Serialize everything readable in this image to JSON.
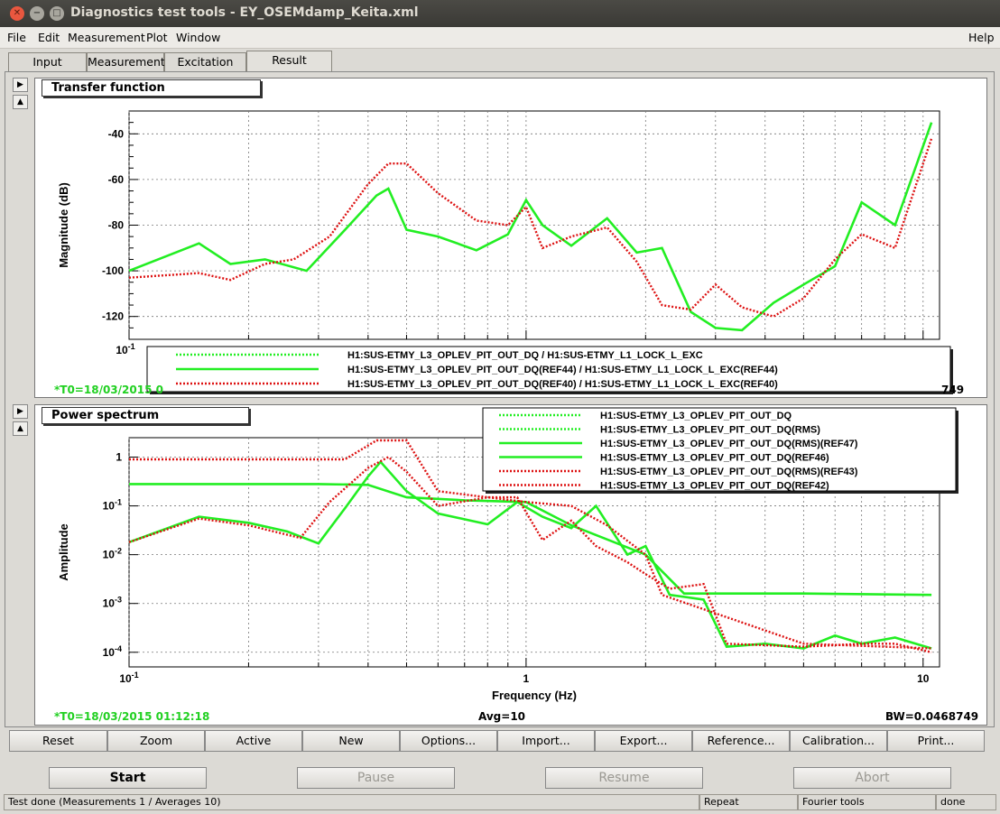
{
  "window": {
    "title": "Diagnostics test tools - EY_OSEMdamp_Keita.xml"
  },
  "menu": {
    "file": "File",
    "edit": "Edit",
    "measurement": "Measurement",
    "plot": "Plot",
    "window": "Window",
    "help": "Help"
  },
  "tabs": [
    "Input",
    "Measurement",
    "Excitation",
    "Result"
  ],
  "top_panel": {
    "title": "Transfer function",
    "ylabel": "Magnitude (dB)",
    "t0_left": "*T0=18/03/2015 0",
    "bw_right": "749",
    "legend": [
      "H1:SUS-ETMY_L3_OPLEV_PIT_OUT_DQ / H1:SUS-ETMY_L1_LOCK_L_EXC",
      "H1:SUS-ETMY_L3_OPLEV_PIT_OUT_DQ(REF44) / H1:SUS-ETMY_L1_LOCK_L_EXC(REF44)",
      "H1:SUS-ETMY_L3_OPLEV_PIT_OUT_DQ(REF40) / H1:SUS-ETMY_L1_LOCK_L_EXC(REF40)"
    ],
    "yticks": [
      "-40",
      "-60",
      "-80",
      "-100",
      "-120"
    ],
    "xtick_first": "10^-1"
  },
  "bottom_panel": {
    "title": "Power spectrum",
    "ylabel": "Amplitude",
    "xlabel": "Frequency (Hz)",
    "t0": "*T0=18/03/2015 01:12:18",
    "avg": "Avg=10",
    "bw": "BW=0.0468749",
    "legend": [
      "H1:SUS-ETMY_L3_OPLEV_PIT_OUT_DQ",
      "H1:SUS-ETMY_L3_OPLEV_PIT_OUT_DQ(RMS)",
      "H1:SUS-ETMY_L3_OPLEV_PIT_OUT_DQ(RMS)(REF47)",
      "H1:SUS-ETMY_L3_OPLEV_PIT_OUT_DQ(REF46)",
      "H1:SUS-ETMY_L3_OPLEV_PIT_OUT_DQ(RMS)(REF43)",
      "H1:SUS-ETMY_L3_OPLEV_PIT_OUT_DQ(REF42)"
    ],
    "yticks": [
      "1",
      "10^-1",
      "10^-2",
      "10^-3",
      "10^-4"
    ],
    "xticks": [
      "10^-1",
      "1",
      "10"
    ]
  },
  "buttons": [
    "Reset",
    "Zoom",
    "Active",
    "New",
    "Options...",
    "Import...",
    "Export...",
    "Reference...",
    "Calibration...",
    "Print..."
  ],
  "main_buttons": {
    "start": "Start",
    "pause": "Pause",
    "resume": "Resume",
    "abort": "Abort"
  },
  "status": {
    "msg": "Test done (Measurements 1 / Averages 10)",
    "repeat": "Repeat",
    "tools": "Fourier tools",
    "state": "done"
  },
  "chart_data": [
    {
      "type": "line",
      "title": "Transfer function",
      "xlabel": "",
      "ylabel": "Magnitude (dB)",
      "xscale": "log",
      "ylim": [
        -130,
        -30
      ],
      "series": [
        {
          "name": "H1:SUS-ETMY_L3_OPLEV_PIT_OUT_DQ(REF44) / H1:SUS-ETMY_L1_LOCK_L_EXC(REF44)",
          "style": "solid",
          "color": "#22ee22",
          "x": [
            0.1,
            0.15,
            0.18,
            0.22,
            0.28,
            0.35,
            0.42,
            0.45,
            0.5,
            0.6,
            0.75,
            0.9,
            1.0,
            1.1,
            1.3,
            1.6,
            1.9,
            2.2,
            2.6,
            3.0,
            3.5,
            4.2,
            5.0,
            6.0,
            7.0,
            8.5,
            10.5
          ],
          "y": [
            -100,
            -88,
            -97,
            -95,
            -100,
            -82,
            -67,
            -64,
            -82,
            -85,
            -91,
            -84,
            -69,
            -80,
            -89,
            -77,
            -92,
            -90,
            -118,
            -125,
            -126,
            -114,
            -106,
            -98,
            -70,
            -80,
            -35
          ]
        },
        {
          "name": "H1:SUS-ETMY_L3_OPLEV_PIT_OUT_DQ(REF40) / H1:SUS-ETMY_L1_LOCK_L_EXC(REF40)",
          "style": "dotted",
          "color": "#dd1111",
          "x": [
            0.1,
            0.15,
            0.18,
            0.22,
            0.26,
            0.32,
            0.4,
            0.45,
            0.5,
            0.6,
            0.75,
            0.9,
            1.0,
            1.1,
            1.3,
            1.6,
            1.9,
            2.2,
            2.6,
            3.0,
            3.5,
            4.2,
            5.0,
            6.0,
            7.0,
            8.5,
            10.5
          ],
          "y": [
            -103,
            -101,
            -104,
            -97,
            -95,
            -85,
            -62,
            -53,
            -53,
            -66,
            -78,
            -80,
            -72,
            -90,
            -85,
            -81,
            -96,
            -115,
            -117,
            -106,
            -116,
            -120,
            -112,
            -95,
            -84,
            -90,
            -42
          ]
        }
      ]
    },
    {
      "type": "line",
      "title": "Power spectrum",
      "xlabel": "Frequency (Hz)",
      "ylabel": "Amplitude",
      "xscale": "log",
      "yscale": "log",
      "ylim": [
        0.0001,
        2
      ],
      "series": [
        {
          "name": "H1:SUS-ETMY_L3_OPLEV_PIT_OUT_DQ(REF46)",
          "style": "solid",
          "color": "#22ee22",
          "x": [
            0.1,
            0.15,
            0.2,
            0.25,
            0.3,
            0.35,
            0.4,
            0.43,
            0.5,
            0.6,
            0.8,
            0.95,
            1.1,
            1.3,
            1.5,
            1.8,
            2.0,
            2.3,
            2.8,
            3.2,
            4.0,
            5.0,
            6.0,
            7.0,
            8.5,
            10.5
          ],
          "y": [
            0.018,
            0.06,
            0.045,
            0.03,
            0.017,
            0.09,
            0.4,
            0.8,
            0.2,
            0.07,
            0.042,
            0.12,
            0.06,
            0.035,
            0.1,
            0.01,
            0.015,
            0.0015,
            0.0012,
            0.00013,
            0.00015,
            0.00012,
            0.00022,
            0.00015,
            0.0002,
            0.00012
          ]
        },
        {
          "name": "H1:SUS-ETMY_L3_OPLEV_PIT_OUT_DQ(RMS)(REF47)",
          "style": "solid",
          "color": "#22ee22",
          "x": [
            0.1,
            0.3,
            0.4,
            0.5,
            0.7,
            1.0,
            1.3,
            2.0,
            2.5,
            5.0,
            10.5
          ],
          "y": [
            0.28,
            0.28,
            0.27,
            0.15,
            0.13,
            0.12,
            0.04,
            0.01,
            0.0016,
            0.0016,
            0.0015
          ]
        },
        {
          "name": "H1:SUS-ETMY_L3_OPLEV_PIT_OUT_DQ(REF42)",
          "style": "dotted",
          "color": "#dd1111",
          "x": [
            0.1,
            0.15,
            0.2,
            0.27,
            0.32,
            0.4,
            0.45,
            0.5,
            0.6,
            0.8,
            0.95,
            1.1,
            1.3,
            1.5,
            1.8,
            2.0,
            2.3,
            2.8,
            3.2,
            4.0,
            5.0,
            6.0,
            7.0,
            8.5,
            10.5
          ],
          "y": [
            0.018,
            0.055,
            0.04,
            0.022,
            0.12,
            0.6,
            1.0,
            0.5,
            0.1,
            0.15,
            0.15,
            0.02,
            0.05,
            0.015,
            0.007,
            0.004,
            0.002,
            0.0025,
            0.00015,
            0.00014,
            0.00013,
            0.00014,
            0.00015,
            0.00015,
            0.0001
          ]
        },
        {
          "name": "H1:SUS-ETMY_L3_OPLEV_PIT_OUT_DQ(RMS)(REF43)",
          "style": "dotted",
          "color": "#dd1111",
          "x": [
            0.1,
            0.35,
            0.42,
            0.5,
            0.6,
            0.8,
            1.0,
            1.3,
            1.6,
            2.0,
            2.2,
            5.0,
            10.5
          ],
          "y": [
            0.9,
            0.9,
            2.2,
            2.2,
            0.2,
            0.15,
            0.12,
            0.1,
            0.04,
            0.01,
            0.0015,
            0.00015,
            0.00012
          ]
        }
      ]
    }
  ]
}
